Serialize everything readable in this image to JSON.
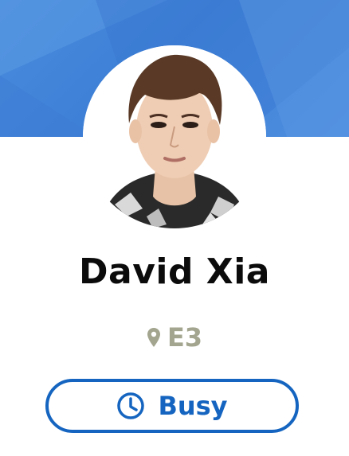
{
  "profile": {
    "name": "David Xia",
    "location": "E3",
    "status": "Busy"
  },
  "icons": {
    "location": "map-pin-icon",
    "status": "clock-icon"
  },
  "colors": {
    "banner": "#4a8cdc",
    "status_accent": "#1565c0",
    "location_text": "#a3a58e",
    "name_text": "#0b0b0b"
  }
}
